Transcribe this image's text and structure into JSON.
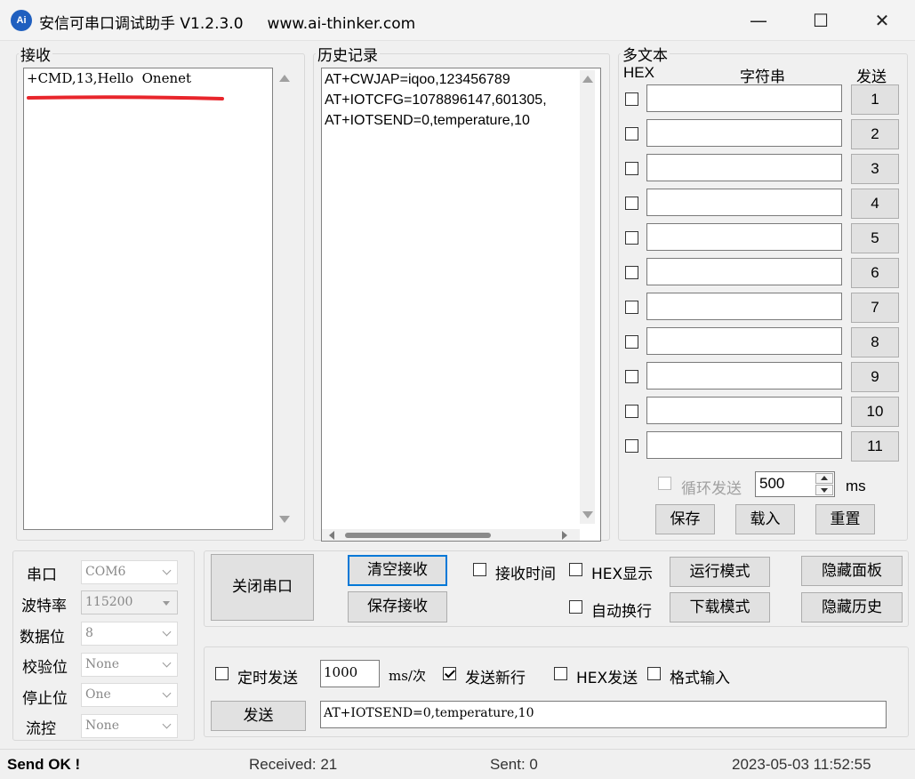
{
  "window": {
    "title": "安信可串口调试助手 V1.2.3.0",
    "url": "www.ai-thinker.com",
    "logo_text": "Ai",
    "minimize_symbol": "—",
    "maximize_symbol": "☐",
    "close_symbol": "✕"
  },
  "receive": {
    "label": "接收",
    "text": "+CMD,13,Hello  Onenet",
    "underline_color": "#e8252b"
  },
  "history": {
    "label": "历史记录",
    "lines": [
      "AT+CWJAP=iqoo,123456789",
      "AT+IOTCFG=1078896147,601305,",
      "AT+IOTSEND=0,temperature,10"
    ]
  },
  "multitext": {
    "label": "多文本",
    "col_hex": "HEX",
    "col_string": "字符串",
    "col_send": "发送",
    "rows": [
      {
        "num": "1",
        "value": ""
      },
      {
        "num": "2",
        "value": ""
      },
      {
        "num": "3",
        "value": ""
      },
      {
        "num": "4",
        "value": ""
      },
      {
        "num": "5",
        "value": ""
      },
      {
        "num": "6",
        "value": ""
      },
      {
        "num": "7",
        "value": ""
      },
      {
        "num": "8",
        "value": ""
      },
      {
        "num": "9",
        "value": ""
      },
      {
        "num": "10",
        "value": ""
      },
      {
        "num": "11",
        "value": ""
      }
    ],
    "loop_send_label": "循环发送",
    "loop_interval": "500",
    "loop_unit": "ms",
    "save_label": "保存",
    "load_label": "载入",
    "reset_label": "重置"
  },
  "port_settings": {
    "port_label": "串口",
    "port_value": "COM6",
    "baud_label": "波特率",
    "baud_value": "115200",
    "databits_label": "数据位",
    "databits_value": "8",
    "parity_label": "校验位",
    "parity_value": "None",
    "stopbits_label": "停止位",
    "stopbits_value": "One",
    "flow_label": "流控",
    "flow_value": "None"
  },
  "controls": {
    "close_port_label": "关闭串口",
    "clear_recv_label": "清空接收",
    "save_recv_label": "保存接收",
    "recv_time_label": "接收时间",
    "hex_display_label": "HEX显示",
    "auto_newline_label": "自动换行",
    "run_mode_label": "运行模式",
    "download_mode_label": "下载模式",
    "hide_panel_label": "隐藏面板",
    "hide_history_label": "隐藏历史"
  },
  "send": {
    "timed_send_label": "定时发送",
    "timed_interval": "1000",
    "timed_unit": "ms/次",
    "send_newline_label": "发送新行",
    "send_newline_checked": true,
    "hex_send_label": "HEX发送",
    "format_input_label": "格式输入",
    "send_button_label": "发送",
    "send_text": "AT+IOTSEND=0,temperature,10"
  },
  "status": {
    "message": "Send OK !",
    "received": "Received: 21",
    "sent": "Sent: 0",
    "datetime": "2023-05-03 11:52:55"
  }
}
